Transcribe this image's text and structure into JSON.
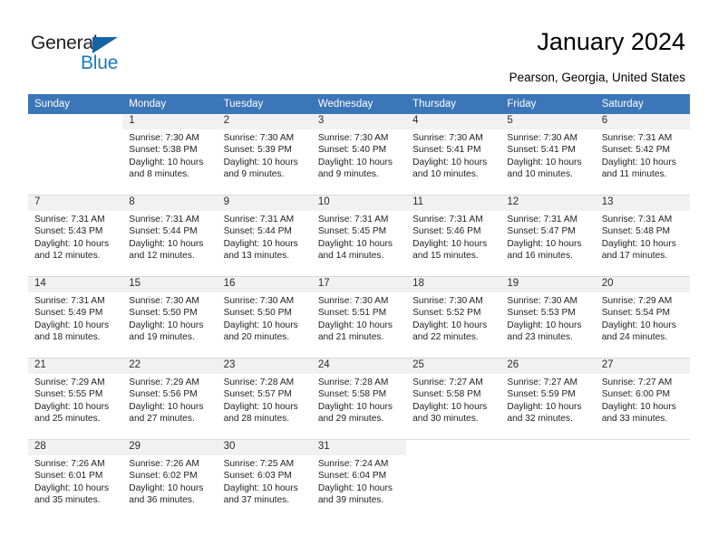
{
  "brand": {
    "name_part1": "General",
    "name_part2": "Blue",
    "triangle_icon": "triangle-icon",
    "color_dark": "#231f20",
    "color_blue": "#1779c4"
  },
  "header": {
    "title": "January 2024",
    "location": "Pearson, Georgia, United States"
  },
  "theme": {
    "header_row_bg": "#3a76b8",
    "header_row_text": "#ffffff",
    "daynum_band_bg": "#f1f1f1",
    "grid_line": "#d9d9d9",
    "body_text": "#222222"
  },
  "weekday_headers": [
    "Sunday",
    "Monday",
    "Tuesday",
    "Wednesday",
    "Thursday",
    "Friday",
    "Saturday"
  ],
  "weeks": [
    [
      {
        "day": "",
        "blank": true,
        "sunrise": "",
        "sunset": "",
        "daylight_line1": "",
        "daylight_line2": ""
      },
      {
        "day": "1",
        "sunrise": "Sunrise: 7:30 AM",
        "sunset": "Sunset: 5:38 PM",
        "daylight_line1": "Daylight: 10 hours",
        "daylight_line2": "and 8 minutes."
      },
      {
        "day": "2",
        "sunrise": "Sunrise: 7:30 AM",
        "sunset": "Sunset: 5:39 PM",
        "daylight_line1": "Daylight: 10 hours",
        "daylight_line2": "and 9 minutes."
      },
      {
        "day": "3",
        "sunrise": "Sunrise: 7:30 AM",
        "sunset": "Sunset: 5:40 PM",
        "daylight_line1": "Daylight: 10 hours",
        "daylight_line2": "and 9 minutes."
      },
      {
        "day": "4",
        "sunrise": "Sunrise: 7:30 AM",
        "sunset": "Sunset: 5:41 PM",
        "daylight_line1": "Daylight: 10 hours",
        "daylight_line2": "and 10 minutes."
      },
      {
        "day": "5",
        "sunrise": "Sunrise: 7:30 AM",
        "sunset": "Sunset: 5:41 PM",
        "daylight_line1": "Daylight: 10 hours",
        "daylight_line2": "and 10 minutes."
      },
      {
        "day": "6",
        "sunrise": "Sunrise: 7:31 AM",
        "sunset": "Sunset: 5:42 PM",
        "daylight_line1": "Daylight: 10 hours",
        "daylight_line2": "and 11 minutes."
      }
    ],
    [
      {
        "day": "7",
        "sunrise": "Sunrise: 7:31 AM",
        "sunset": "Sunset: 5:43 PM",
        "daylight_line1": "Daylight: 10 hours",
        "daylight_line2": "and 12 minutes."
      },
      {
        "day": "8",
        "sunrise": "Sunrise: 7:31 AM",
        "sunset": "Sunset: 5:44 PM",
        "daylight_line1": "Daylight: 10 hours",
        "daylight_line2": "and 12 minutes."
      },
      {
        "day": "9",
        "sunrise": "Sunrise: 7:31 AM",
        "sunset": "Sunset: 5:44 PM",
        "daylight_line1": "Daylight: 10 hours",
        "daylight_line2": "and 13 minutes."
      },
      {
        "day": "10",
        "sunrise": "Sunrise: 7:31 AM",
        "sunset": "Sunset: 5:45 PM",
        "daylight_line1": "Daylight: 10 hours",
        "daylight_line2": "and 14 minutes."
      },
      {
        "day": "11",
        "sunrise": "Sunrise: 7:31 AM",
        "sunset": "Sunset: 5:46 PM",
        "daylight_line1": "Daylight: 10 hours",
        "daylight_line2": "and 15 minutes."
      },
      {
        "day": "12",
        "sunrise": "Sunrise: 7:31 AM",
        "sunset": "Sunset: 5:47 PM",
        "daylight_line1": "Daylight: 10 hours",
        "daylight_line2": "and 16 minutes."
      },
      {
        "day": "13",
        "sunrise": "Sunrise: 7:31 AM",
        "sunset": "Sunset: 5:48 PM",
        "daylight_line1": "Daylight: 10 hours",
        "daylight_line2": "and 17 minutes."
      }
    ],
    [
      {
        "day": "14",
        "sunrise": "Sunrise: 7:31 AM",
        "sunset": "Sunset: 5:49 PM",
        "daylight_line1": "Daylight: 10 hours",
        "daylight_line2": "and 18 minutes."
      },
      {
        "day": "15",
        "sunrise": "Sunrise: 7:30 AM",
        "sunset": "Sunset: 5:50 PM",
        "daylight_line1": "Daylight: 10 hours",
        "daylight_line2": "and 19 minutes."
      },
      {
        "day": "16",
        "sunrise": "Sunrise: 7:30 AM",
        "sunset": "Sunset: 5:50 PM",
        "daylight_line1": "Daylight: 10 hours",
        "daylight_line2": "and 20 minutes."
      },
      {
        "day": "17",
        "sunrise": "Sunrise: 7:30 AM",
        "sunset": "Sunset: 5:51 PM",
        "daylight_line1": "Daylight: 10 hours",
        "daylight_line2": "and 21 minutes."
      },
      {
        "day": "18",
        "sunrise": "Sunrise: 7:30 AM",
        "sunset": "Sunset: 5:52 PM",
        "daylight_line1": "Daylight: 10 hours",
        "daylight_line2": "and 22 minutes."
      },
      {
        "day": "19",
        "sunrise": "Sunrise: 7:30 AM",
        "sunset": "Sunset: 5:53 PM",
        "daylight_line1": "Daylight: 10 hours",
        "daylight_line2": "and 23 minutes."
      },
      {
        "day": "20",
        "sunrise": "Sunrise: 7:29 AM",
        "sunset": "Sunset: 5:54 PM",
        "daylight_line1": "Daylight: 10 hours",
        "daylight_line2": "and 24 minutes."
      }
    ],
    [
      {
        "day": "21",
        "sunrise": "Sunrise: 7:29 AM",
        "sunset": "Sunset: 5:55 PM",
        "daylight_line1": "Daylight: 10 hours",
        "daylight_line2": "and 25 minutes."
      },
      {
        "day": "22",
        "sunrise": "Sunrise: 7:29 AM",
        "sunset": "Sunset: 5:56 PM",
        "daylight_line1": "Daylight: 10 hours",
        "daylight_line2": "and 27 minutes."
      },
      {
        "day": "23",
        "sunrise": "Sunrise: 7:28 AM",
        "sunset": "Sunset: 5:57 PM",
        "daylight_line1": "Daylight: 10 hours",
        "daylight_line2": "and 28 minutes."
      },
      {
        "day": "24",
        "sunrise": "Sunrise: 7:28 AM",
        "sunset": "Sunset: 5:58 PM",
        "daylight_line1": "Daylight: 10 hours",
        "daylight_line2": "and 29 minutes."
      },
      {
        "day": "25",
        "sunrise": "Sunrise: 7:27 AM",
        "sunset": "Sunset: 5:58 PM",
        "daylight_line1": "Daylight: 10 hours",
        "daylight_line2": "and 30 minutes."
      },
      {
        "day": "26",
        "sunrise": "Sunrise: 7:27 AM",
        "sunset": "Sunset: 5:59 PM",
        "daylight_line1": "Daylight: 10 hours",
        "daylight_line2": "and 32 minutes."
      },
      {
        "day": "27",
        "sunrise": "Sunrise: 7:27 AM",
        "sunset": "Sunset: 6:00 PM",
        "daylight_line1": "Daylight: 10 hours",
        "daylight_line2": "and 33 minutes."
      }
    ],
    [
      {
        "day": "28",
        "sunrise": "Sunrise: 7:26 AM",
        "sunset": "Sunset: 6:01 PM",
        "daylight_line1": "Daylight: 10 hours",
        "daylight_line2": "and 35 minutes."
      },
      {
        "day": "29",
        "sunrise": "Sunrise: 7:26 AM",
        "sunset": "Sunset: 6:02 PM",
        "daylight_line1": "Daylight: 10 hours",
        "daylight_line2": "and 36 minutes."
      },
      {
        "day": "30",
        "sunrise": "Sunrise: 7:25 AM",
        "sunset": "Sunset: 6:03 PM",
        "daylight_line1": "Daylight: 10 hours",
        "daylight_line2": "and 37 minutes."
      },
      {
        "day": "31",
        "sunrise": "Sunrise: 7:24 AM",
        "sunset": "Sunset: 6:04 PM",
        "daylight_line1": "Daylight: 10 hours",
        "daylight_line2": "and 39 minutes."
      },
      {
        "day": "",
        "blank": true,
        "sunrise": "",
        "sunset": "",
        "daylight_line1": "",
        "daylight_line2": ""
      },
      {
        "day": "",
        "blank": true,
        "sunrise": "",
        "sunset": "",
        "daylight_line1": "",
        "daylight_line2": ""
      },
      {
        "day": "",
        "blank": true,
        "sunrise": "",
        "sunset": "",
        "daylight_line1": "",
        "daylight_line2": ""
      }
    ]
  ]
}
